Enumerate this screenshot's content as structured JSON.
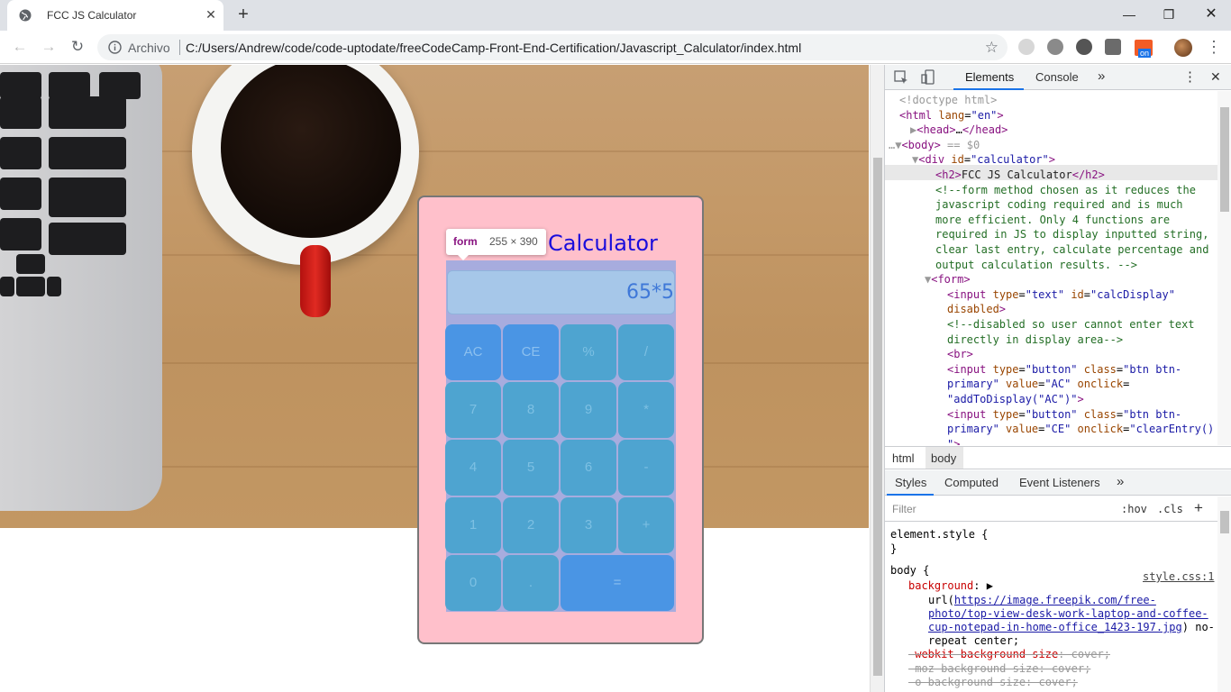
{
  "browser": {
    "tab_title": "FCC JS Calculator",
    "tab_close": "✕",
    "new_tab": "+",
    "win_minimize": "—",
    "win_restore": "❐",
    "win_close": "✕",
    "back": "←",
    "forward": "→",
    "reload": "↻",
    "site_info_label": "Archivo",
    "url": "C:/Users/Andrew/code/code-uptodate/freeCodeCamp-Front-End-Certification/Javascript_Calculator/index.html",
    "bookmark_star": "☆",
    "extension_badge": "on"
  },
  "page": {
    "calculator_title": "Calculator",
    "display_value": "65*5",
    "buttons": [
      [
        "AC",
        "CE",
        "%",
        "/"
      ],
      [
        "7",
        "8",
        "9",
        "*"
      ],
      [
        "4",
        "5",
        "6",
        "-"
      ],
      [
        "1",
        "2",
        "3",
        "+"
      ],
      [
        "0",
        ".",
        "="
      ]
    ],
    "inspect_tooltip": {
      "tag": "form",
      "size": "255 × 390"
    }
  },
  "devtools": {
    "tabs": [
      "Elements",
      "Console"
    ],
    "more_tabs": "»",
    "menu": "⋮",
    "close": "✕",
    "dom_lines": [
      {
        "indent": 16,
        "html": "<span class='dim'>&lt;!doctype html&gt;</span>"
      },
      {
        "indent": 16,
        "html": "<span class='tag'>&lt;html</span> <span class='attr'>lang</span>=<span class='val'>\"en\"</span><span class='tag'>&gt;</span>"
      },
      {
        "indent": 28,
        "html": "<span class='dim'>▶</span><span class='tag'>&lt;head&gt;</span>…<span class='tag'>&lt;/head&gt;</span>"
      },
      {
        "indent": 4,
        "html": "<span class='dim'>…▼</span><span class='tag'>&lt;body&gt;</span> <span class='dim'>== $0</span>"
      },
      {
        "indent": 30,
        "html": "<span class='dim'>▼</span><span class='tag'>&lt;div</span> <span class='attr'>id</span>=<span class='val'>\"calculator\"</span><span class='tag'>&gt;</span>"
      },
      {
        "indent": 56,
        "html": "<span class='tag'>&lt;h2&gt;</span><span class='txt'>FCC JS Calculator</span><span class='tag'>&lt;/h2&gt;</span>"
      },
      {
        "indent": 56,
        "html": "<span class='cmt'>&lt;!--form method chosen as it reduces the</span>"
      },
      {
        "indent": 56,
        "html": "<span class='cmt'>javascript coding required and is much</span>"
      },
      {
        "indent": 56,
        "html": "<span class='cmt'>more efficient. Only 4 functions are</span>"
      },
      {
        "indent": 56,
        "html": "<span class='cmt'>required in JS to display inputted string,</span>"
      },
      {
        "indent": 56,
        "html": "<span class='cmt'>clear last entry, calculate percentage and</span>"
      },
      {
        "indent": 56,
        "html": "<span class='cmt'>output calculation results. --&gt;</span>"
      },
      {
        "indent": 44,
        "html": "<span class='dim'>▼</span><span class='tag'>&lt;form&gt;</span>"
      },
      {
        "indent": 69,
        "html": "<span class='tag'>&lt;input</span> <span class='attr'>type</span>=<span class='val'>\"text\"</span> <span class='attr'>id</span>=<span class='val'>\"calcDisplay\"</span>"
      },
      {
        "indent": 69,
        "html": "<span class='attr'>disabled</span><span class='tag'>&gt;</span>"
      },
      {
        "indent": 69,
        "html": "<span class='cmt'>&lt;!--disabled so user cannot enter text</span>"
      },
      {
        "indent": 69,
        "html": "<span class='cmt'>directly in display area--&gt;</span>"
      },
      {
        "indent": 69,
        "html": "<span class='tag'>&lt;br&gt;</span>"
      },
      {
        "indent": 69,
        "html": "<span class='tag'>&lt;input</span> <span class='attr'>type</span>=<span class='val'>\"button\"</span> <span class='attr'>class</span>=<span class='val'>\"btn btn-</span>"
      },
      {
        "indent": 69,
        "html": "<span class='val'>primary\"</span> <span class='attr'>value</span>=<span class='val'>\"AC\"</span> <span class='attr'>onclick</span>="
      },
      {
        "indent": 69,
        "html": "<span class='val'>\"addToDisplay(\"AC\")\"</span><span class='tag'>&gt;</span>"
      },
      {
        "indent": 69,
        "html": "<span class='tag'>&lt;input</span> <span class='attr'>type</span>=<span class='val'>\"button\"</span> <span class='attr'>class</span>=<span class='val'>\"btn btn-</span>"
      },
      {
        "indent": 69,
        "html": "<span class='val'>primary\"</span> <span class='attr'>value</span>=<span class='val'>\"CE\"</span> <span class='attr'>onclick</span>=<span class='val'>\"clearEntry()</span>"
      },
      {
        "indent": 69,
        "html": "<span class='val'>\"</span><span class='tag'>&gt;</span>"
      }
    ],
    "breadcrumbs": [
      "html",
      "body"
    ],
    "sub_tabs": [
      "Styles",
      "Computed",
      "Event Listeners"
    ],
    "sub_more": "»",
    "filter_placeholder": "Filter",
    "hov": ":hov",
    "cls": ".cls",
    "add_rule": "+",
    "style_lines": [
      {
        "indent": 6,
        "html": "<span>element.style {</span>"
      },
      {
        "indent": 6,
        "html": "<span>}</span>"
      },
      {
        "indent": 6,
        "html": " "
      },
      {
        "indent": 6,
        "html": "<span>body {</span>"
      },
      {
        "indent": 26,
        "html": "<span class='prop'>background</span>: ▶"
      },
      {
        "indent": 48,
        "html": "url(<span class='link'>https://image.freepik.com/free-</span>"
      },
      {
        "indent": 48,
        "html": "<span class='link'>photo/top-view-desk-work-laptop-and-coffee-</span>"
      },
      {
        "indent": 48,
        "html": "<span class='link'>cup-notepad-in-home-office_1423-197.jpg</span>) no-"
      },
      {
        "indent": 48,
        "html": "repeat center;"
      },
      {
        "indent": 26,
        "html": "<span class='strike'><span class='prop'>-webkit-background-size</span>: cover;</span>"
      },
      {
        "indent": 26,
        "html": "<span class='strike'>-moz-background-size: cover;</span>"
      },
      {
        "indent": 26,
        "html": "<span class='strike'>-o-background-size: cover;</span>"
      }
    ],
    "style_source": "style.css:1"
  }
}
